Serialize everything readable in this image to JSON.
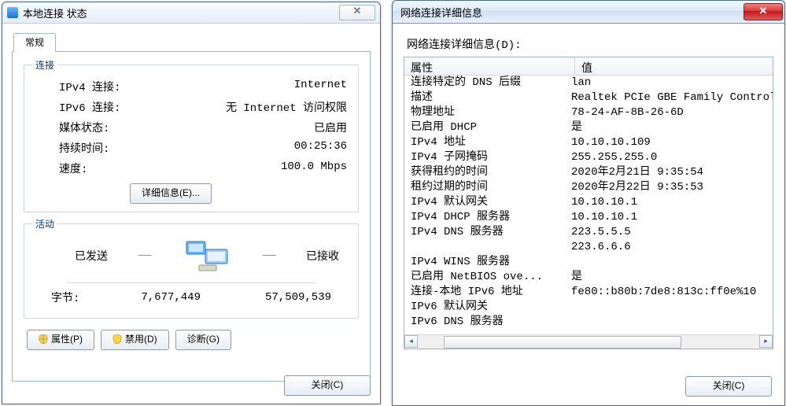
{
  "status": {
    "title": "本地连接 状态",
    "tab_general": "常规",
    "group_conn": {
      "legend": "连接",
      "ipv4_label": "IPv4 连接:",
      "ipv4_value": "Internet",
      "ipv6_label": "IPv6 连接:",
      "ipv6_value": "无 Internet 访问权限",
      "media_label": "媒体状态:",
      "media_value": "已启用",
      "duration_label": "持续时间:",
      "duration_value": "00:25:36",
      "speed_label": "速度:",
      "speed_value": "100.0 Mbps",
      "details_button": "详细信息(E)..."
    },
    "group_act": {
      "legend": "活动",
      "sent_label": "已发送",
      "recv_label": "已接收",
      "bytes_label": "字节:",
      "bytes_sent": "7,677,449",
      "bytes_recv": "57,509,539"
    },
    "buttons": {
      "properties": "属性(P)",
      "disable": "禁用(D)",
      "diagnose": "诊断(G)",
      "close": "关闭(C)"
    }
  },
  "details": {
    "title": "网络连接详细信息",
    "heading": "网络连接详细信息(D):",
    "columns": {
      "prop": "属性",
      "value": "值"
    },
    "rows": [
      {
        "p": "连接特定的 DNS 后缀",
        "v": "lan"
      },
      {
        "p": "描述",
        "v": "Realtek PCIe GBE Family Control"
      },
      {
        "p": "物理地址",
        "v": "78-24-AF-8B-26-6D"
      },
      {
        "p": "已启用 DHCP",
        "v": "是"
      },
      {
        "p": "IPv4 地址",
        "v": "10.10.10.109"
      },
      {
        "p": "IPv4 子网掩码",
        "v": "255.255.255.0"
      },
      {
        "p": "获得租约的时间",
        "v": "2020年2月21日 9:35:54"
      },
      {
        "p": "租约过期的时间",
        "v": "2020年2月22日 9:35:53"
      },
      {
        "p": "IPv4 默认网关",
        "v": "10.10.10.1"
      },
      {
        "p": "IPv4 DHCP 服务器",
        "v": "10.10.10.1"
      },
      {
        "p": "IPv4 DNS 服务器",
        "v": "223.5.5.5"
      },
      {
        "p": "",
        "v": "223.6.6.6"
      },
      {
        "p": "IPv4 WINS 服务器",
        "v": ""
      },
      {
        "p": "已启用 NetBIOS ove...",
        "v": "是"
      },
      {
        "p": "连接-本地 IPv6 地址",
        "v": "fe80::b80b:7de8:813c:ff0e%10"
      },
      {
        "p": "IPv6 默认网关",
        "v": ""
      },
      {
        "p": "IPv6 DNS 服务器",
        "v": ""
      }
    ],
    "close": "关闭(C)"
  }
}
